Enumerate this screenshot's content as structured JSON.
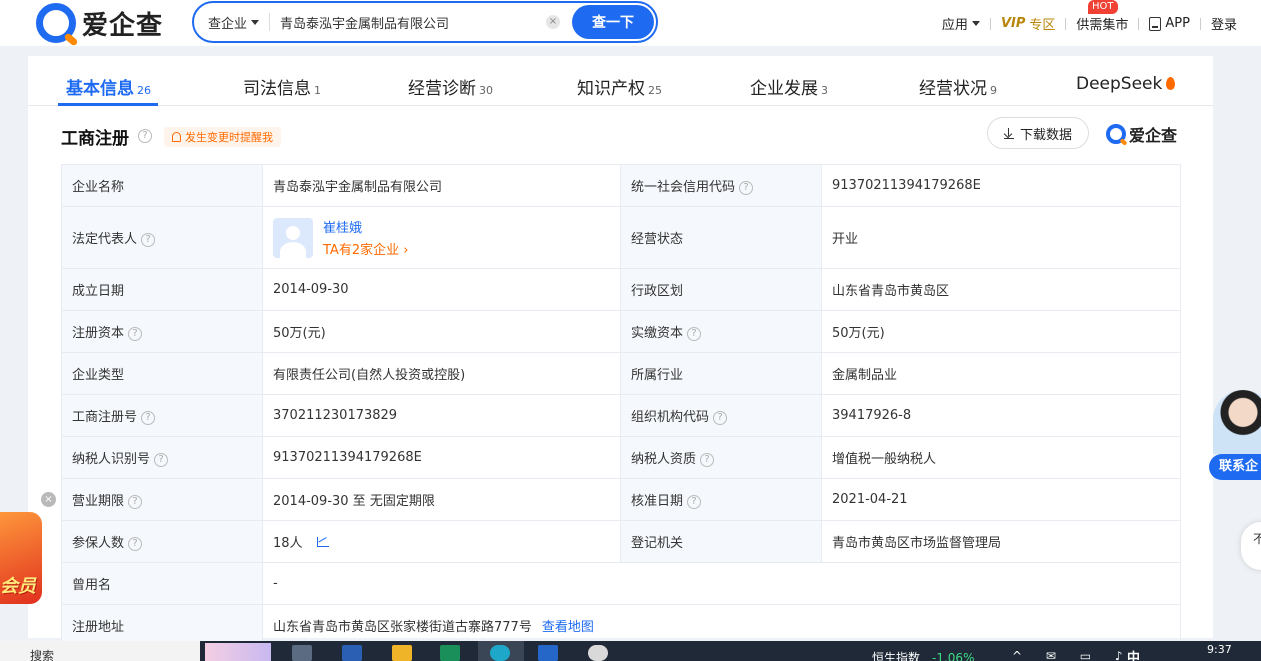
{
  "brand": {
    "name": "爱企查"
  },
  "search": {
    "type_label": "查企业",
    "query": "青岛泰泓宇金属制品有限公司",
    "clear": "×",
    "button": "查一下"
  },
  "nav": {
    "apps": "应用",
    "vip": "VIP",
    "vip_zone": "专区",
    "supply": "供需集市",
    "hot": "HOT",
    "app": "APP",
    "login": "登录"
  },
  "tabs": [
    {
      "label": "基本信息",
      "count": "26"
    },
    {
      "label": "司法信息",
      "count": "1"
    },
    {
      "label": "经营诊断",
      "count": "30"
    },
    {
      "label": "知识产权",
      "count": "25"
    },
    {
      "label": "企业发展",
      "count": "3"
    },
    {
      "label": "经营状况",
      "count": "9"
    },
    {
      "label": "DeepSeek",
      "count": ""
    }
  ],
  "section": {
    "title": "工商注册",
    "remind": "发生变更时提醒我",
    "download": "下载数据",
    "brand_small": "爱企查",
    "help": "?"
  },
  "table": {
    "company_name_label": "企业名称",
    "company_name": "青岛泰泓宇金属制品有限公司",
    "credit_code_label": "统一社会信用代码",
    "credit_code": "91370211394179268E",
    "legal_rep_label": "法定代表人",
    "legal_rep_name": "崔桂娥",
    "legal_rep_sub": "TA有2家企业 ›",
    "status_label": "经营状态",
    "status": "开业",
    "founded_label": "成立日期",
    "founded": "2014-09-30",
    "region_label": "行政区划",
    "region": "山东省青岛市黄岛区",
    "reg_capital_label": "注册资本",
    "reg_capital": "50万(元)",
    "paid_capital_label": "实缴资本",
    "paid_capital": "50万(元)",
    "type_label": "企业类型",
    "type": "有限责任公司(自然人投资或控股)",
    "industry_label": "所属行业",
    "industry": "金属制品业",
    "reg_no_label": "工商注册号",
    "reg_no": "370211230173829",
    "org_code_label": "组织机构代码",
    "org_code": "39417926-8",
    "tax_id_label": "纳税人识别号",
    "tax_id": "91370211394179268E",
    "tax_qual_label": "纳税人资质",
    "tax_qual": "增值税一般纳税人",
    "term_label": "营业期限",
    "term": "2014-09-30 至 无固定期限",
    "approval_label": "核准日期",
    "approval": "2021-04-21",
    "insured_label": "参保人数",
    "insured": "18人",
    "authority_label": "登记机关",
    "authority": "青岛市黄岛区市场监督管理局",
    "former_name_label": "曾用名",
    "former_name": "-",
    "address_label": "注册地址",
    "address": "山东省青岛市黄岛区张家楼街道古寨路777号",
    "map_link": "查看地图"
  },
  "floating": {
    "promo_close": "×",
    "promo_text": "会员",
    "contact": "联系企",
    "side_circle": "不 置"
  },
  "taskbar": {
    "search": "搜索",
    "stock_name": "恒生指数",
    "stock_pct": "-1.06%",
    "time": "9:37",
    "ime": "中"
  },
  "colors": {
    "primary": "#1e6bf1",
    "accent": "#ff6a00",
    "vip": "#b8860b"
  }
}
